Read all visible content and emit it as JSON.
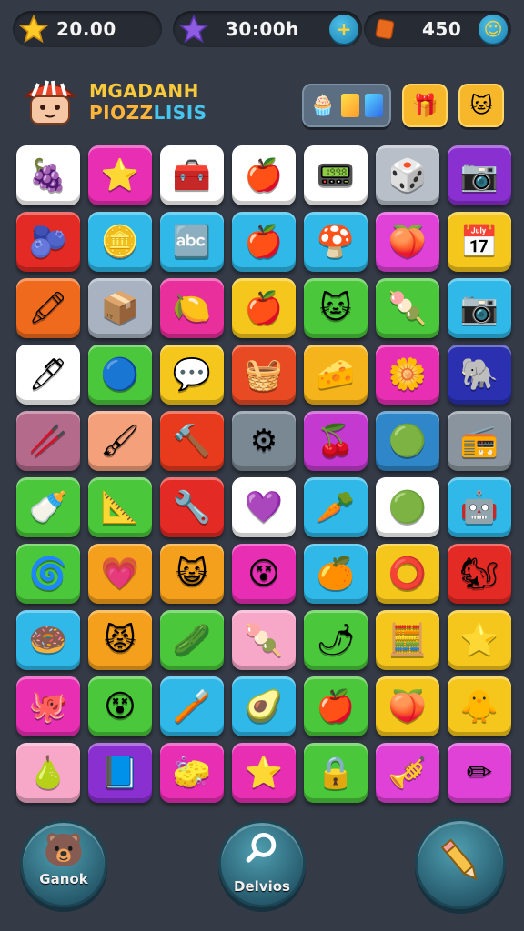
{
  "resources": {
    "coins": {
      "value": "20.00",
      "icon": "star-icon"
    },
    "stars": {
      "value": "30:00h",
      "icon": "purple-star-icon",
      "plus": "+"
    },
    "gems": {
      "value": "450",
      "icon": "gem-icon",
      "plus": "☺"
    }
  },
  "logo": {
    "line1": "MGADANH",
    "line2a": "PIOZZ",
    "line2b": "LISIS"
  },
  "header_buttons": {
    "themes": [
      "🧁",
      "🟨",
      "🟦"
    ],
    "btn1": "🎁",
    "btn2": "🐱"
  },
  "tiles": [
    {
      "icon": "🍇",
      "bg": "#ffffff"
    },
    {
      "icon": "⭐",
      "bg": "#e82fb4"
    },
    {
      "icon": "🧰",
      "bg": "#ffffff"
    },
    {
      "icon": "🍎",
      "bg": "#ffffff"
    },
    {
      "icon": "📟",
      "bg": "#ffffff"
    },
    {
      "icon": "🎲",
      "bg": "#b8bfc8"
    },
    {
      "icon": "📷",
      "bg": "#8a2fd0"
    },
    {
      "icon": "🫐",
      "bg": "#e42a24"
    },
    {
      "icon": "🪙",
      "bg": "#2fb8e8"
    },
    {
      "icon": "🔤",
      "bg": "#2fb8e8"
    },
    {
      "icon": "🍎",
      "bg": "#2fb8e8"
    },
    {
      "icon": "🍄",
      "bg": "#2fb8e8"
    },
    {
      "icon": "🍑",
      "bg": "#e042d8"
    },
    {
      "icon": "📅",
      "bg": "#f5c61c"
    },
    {
      "icon": "🖍",
      "bg": "#f06a1e"
    },
    {
      "icon": "📦",
      "bg": "#a8b2c0"
    },
    {
      "icon": "🍋",
      "bg": "#e82f9c"
    },
    {
      "icon": "🍎",
      "bg": "#f5c61c"
    },
    {
      "icon": "🐱",
      "bg": "#4ac73a"
    },
    {
      "icon": "🍡",
      "bg": "#4ac73a"
    },
    {
      "icon": "📷",
      "bg": "#2fb8e8"
    },
    {
      "icon": "🖊",
      "bg": "#ffffff"
    },
    {
      "icon": "🔵",
      "bg": "#4ac73a"
    },
    {
      "icon": "💬",
      "bg": "#f5c61c"
    },
    {
      "icon": "🧺",
      "bg": "#e84a24"
    },
    {
      "icon": "🧀",
      "bg": "#f5b31c"
    },
    {
      "icon": "🌼",
      "bg": "#e82fb4"
    },
    {
      "icon": "🐘",
      "bg": "#2a30b0"
    },
    {
      "icon": "🥢",
      "bg": "#b46a8a"
    },
    {
      "icon": "🖌",
      "bg": "#f4a07a"
    },
    {
      "icon": "🔨",
      "bg": "#e83a1c"
    },
    {
      "icon": "⚙",
      "bg": "#7a8894"
    },
    {
      "icon": "🍒",
      "bg": "#c43ad0"
    },
    {
      "icon": "🟢",
      "bg": "#2f86c8"
    },
    {
      "icon": "📻",
      "bg": "#8a949e"
    },
    {
      "icon": "🍼",
      "bg": "#4ac73a"
    },
    {
      "icon": "📐",
      "bg": "#4ac73a"
    },
    {
      "icon": "🔧",
      "bg": "#e42a24"
    },
    {
      "icon": "💜",
      "bg": "#ffffff"
    },
    {
      "icon": "🥕",
      "bg": "#2fb8e8"
    },
    {
      "icon": "🟢",
      "bg": "#ffffff"
    },
    {
      "icon": "🤖",
      "bg": "#2fb8e8"
    },
    {
      "icon": "🌀",
      "bg": "#4ac73a"
    },
    {
      "icon": "💗",
      "bg": "#f5a01c"
    },
    {
      "icon": "😺",
      "bg": "#f5a01c"
    },
    {
      "icon": "😵",
      "bg": "#e82fb4"
    },
    {
      "icon": "🍊",
      "bg": "#2fb8e8"
    },
    {
      "icon": "⭕",
      "bg": "#f5c61c"
    },
    {
      "icon": "🐿",
      "bg": "#e42a24"
    },
    {
      "icon": "🍩",
      "bg": "#2fb8e8"
    },
    {
      "icon": "😾",
      "bg": "#f5a01c"
    },
    {
      "icon": "🥒",
      "bg": "#4ac73a"
    },
    {
      "icon": "🍡",
      "bg": "#f7a8c8"
    },
    {
      "icon": "🌶",
      "bg": "#4ac73a"
    },
    {
      "icon": "🧮",
      "bg": "#f5c61c"
    },
    {
      "icon": "⭐",
      "bg": "#f5c61c"
    },
    {
      "icon": "🐙",
      "bg": "#e82fb4"
    },
    {
      "icon": "😵",
      "bg": "#4ac73a"
    },
    {
      "icon": "🪥",
      "bg": "#2fb8e8"
    },
    {
      "icon": "🥑",
      "bg": "#2fb8e8"
    },
    {
      "icon": "🍎",
      "bg": "#4ac73a"
    },
    {
      "icon": "🍑",
      "bg": "#f5c61c"
    },
    {
      "icon": "🐥",
      "bg": "#f5c61c"
    },
    {
      "icon": "🍐",
      "bg": "#f7a8c8"
    },
    {
      "icon": "📘",
      "bg": "#8a2fd0"
    },
    {
      "icon": "🧽",
      "bg": "#e82fb4"
    },
    {
      "icon": "⭐",
      "bg": "#e82fb4"
    },
    {
      "icon": "🔒",
      "bg": "#4ac73a"
    },
    {
      "icon": "🎺",
      "bg": "#e042d8"
    },
    {
      "icon": "✏",
      "bg": "#e042d8"
    }
  ],
  "bottom": {
    "left": {
      "label": "Ganok",
      "icon": "🐻"
    },
    "mid": {
      "label": "Delvios",
      "icon": "🔍"
    },
    "right": {
      "icon": "✏"
    }
  }
}
